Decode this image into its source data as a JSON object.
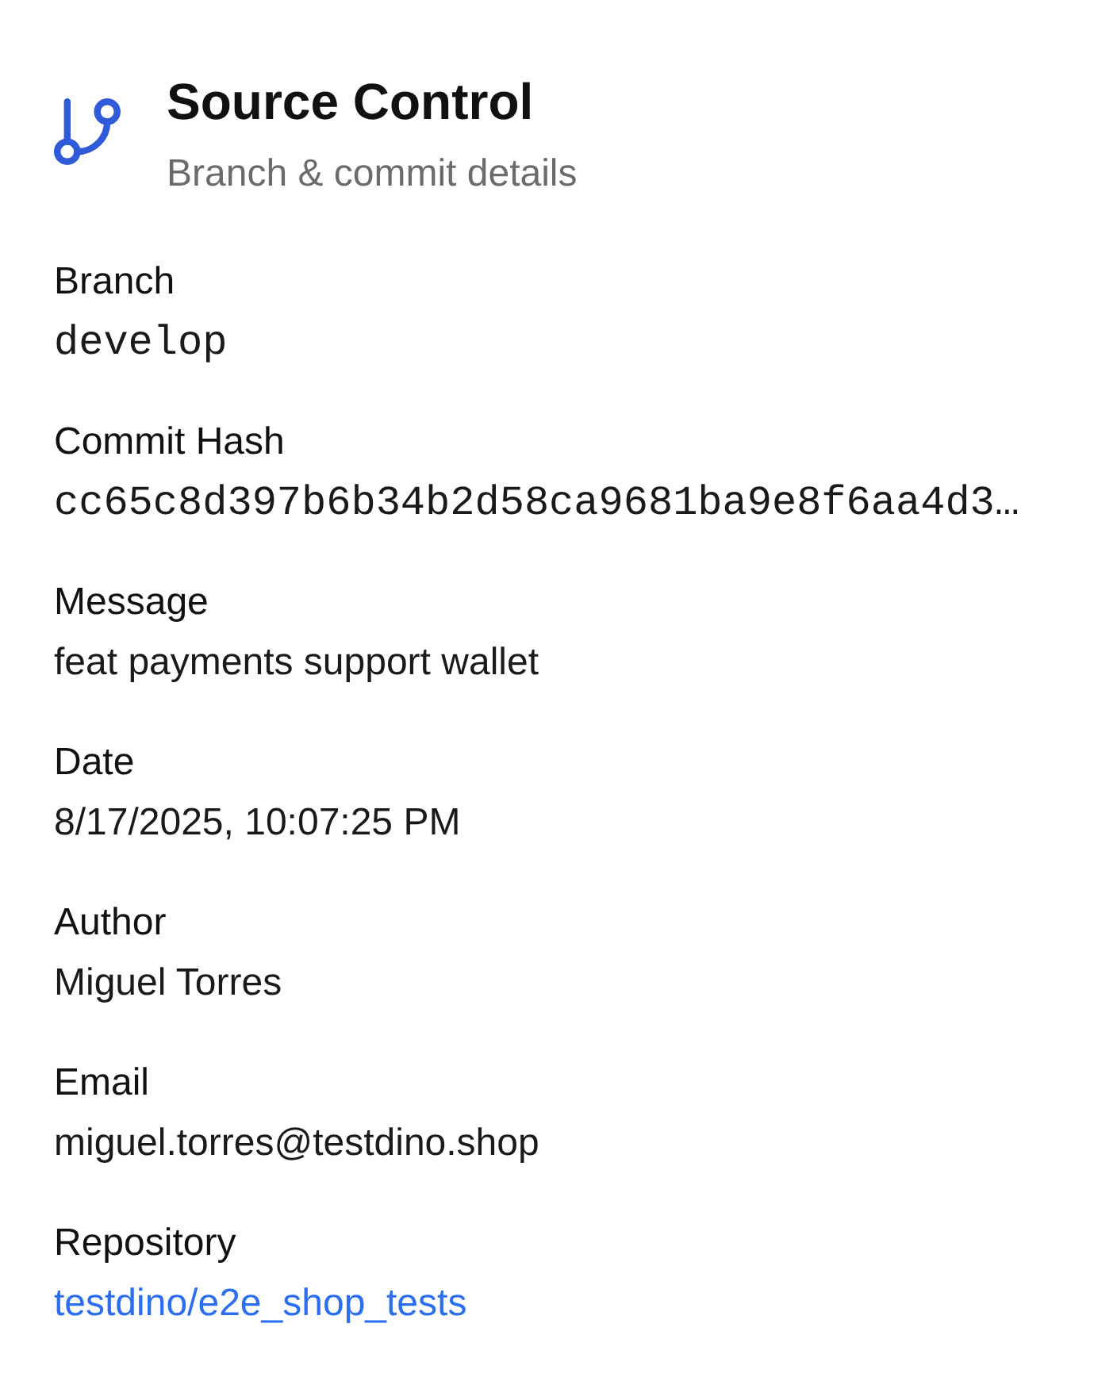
{
  "header": {
    "title": "Source Control",
    "subtitle": "Branch & commit details"
  },
  "fields": [
    {
      "label": "Branch",
      "value": "develop",
      "kind": "code"
    },
    {
      "label": "Commit Hash",
      "value": "cc65c8d397b6b34b2d58ca9681ba9e8f6aa4d3…",
      "kind": "code"
    },
    {
      "label": "Message",
      "value": "feat payments support wallet",
      "kind": "text"
    },
    {
      "label": "Date",
      "value": "8/17/2025, 10:07:25 PM",
      "kind": "text"
    },
    {
      "label": "Author",
      "value": "Miguel Torres",
      "kind": "text"
    },
    {
      "label": "Email",
      "value": "miguel.torres@testdino.shop",
      "kind": "text"
    },
    {
      "label": "Repository",
      "value": "testdino/e2e_shop_tests",
      "kind": "link"
    }
  ]
}
